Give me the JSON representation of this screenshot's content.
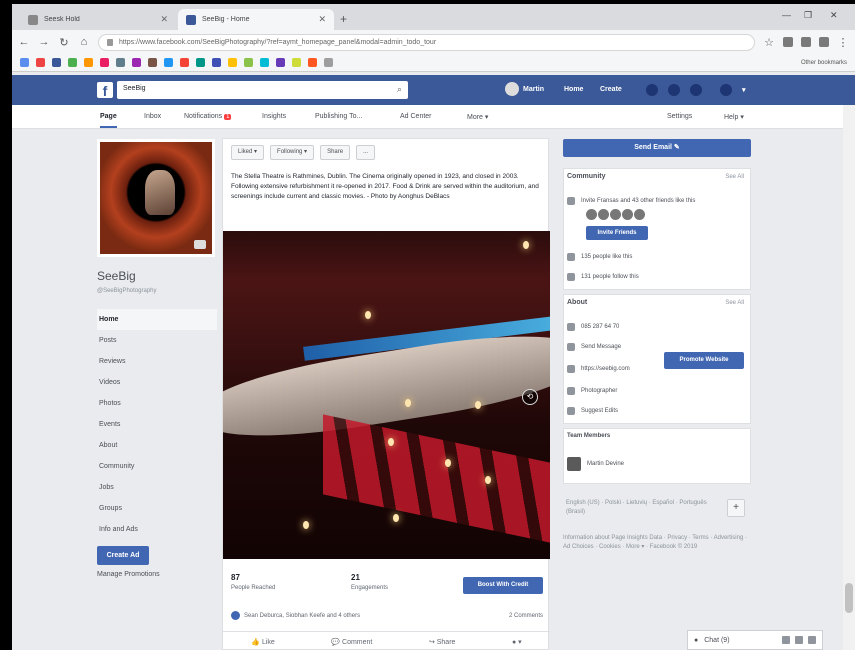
{
  "browser": {
    "tabs": [
      {
        "label": "Seesk Hold"
      },
      {
        "label": "SeeBig - Home"
      }
    ],
    "new_tab": "+",
    "url": "https://www.facebook.com/SeeBigPhotography/?ref=aymt_homepage_panel&modal=admin_todo_tour",
    "window_controls": [
      "—",
      "❐",
      "✕"
    ],
    "bookmarks_other": "Other bookmarks"
  },
  "fb": {
    "logo": "f",
    "search_value": "SeeBig",
    "user_name": "Martin",
    "nav": [
      "Home",
      "Create"
    ]
  },
  "page_tabs": [
    "Page",
    "Inbox",
    "Notifications",
    "Insights",
    "Publishing To...",
    "Ad Center",
    "More ▾",
    "Settings",
    "Help ▾"
  ],
  "notif_count": "1",
  "page": {
    "name": "SeeBig",
    "handle": "@SeeBigPhotography",
    "nav": [
      "Home",
      "Posts",
      "Reviews",
      "Videos",
      "Photos",
      "Events",
      "About",
      "Community",
      "Jobs",
      "Groups",
      "Info and Ads"
    ],
    "create_ad": "Create Ad",
    "manage_promotions": "Manage Promotions"
  },
  "post": {
    "actions": [
      "Liked ▾",
      "Following ▾",
      "Share",
      "..."
    ],
    "text": "The Stella Theatre is Rathmines, Dublin. The Cinema originally opened in 1923, and closed in 2003. Following extensive refurbishment it re-opened in 2017. Food & Drink are served within the auditorium, and screenings include current and classic movies. - Photo by Aonghus DeBlacs",
    "people_reached": "87",
    "people_reached_label": "People Reached",
    "engagements": "21",
    "engagements_label": "Engagements",
    "boost_label": "Boost With Credit",
    "reactions_text": "Sean Deburca, Siobhan Keefe and 4 others",
    "comments_text": "2 Comments",
    "bar": [
      "Like",
      "Comment",
      "Share"
    ]
  },
  "right": {
    "send_email": "Send Email",
    "community": {
      "title": "Community",
      "see_all": "See All",
      "invite_text": "Invite Fransas and 43 other friends like this",
      "invite_button": "Invite Friends",
      "likes": "135 people like this",
      "follows": "131 people follow this"
    },
    "about": {
      "title": "About",
      "see_all": "See All",
      "phone": "085 287 64 70",
      "send_message": "Send Message",
      "website": "https://seebig.com",
      "promote_button": "Promote Website",
      "category": "Photographer",
      "suggest": "Suggest Edits"
    },
    "team": {
      "title": "Team Members",
      "member": "Martin Devine"
    },
    "languages": "English (US) · Polski · Lietuvių · Español · Português (Brasil)",
    "lang_plus": "+",
    "footer": "Information about Page Insights Data · Privacy · Terms · Advertising · Ad Choices · Cookies · More ▾ · Facebook © 2019"
  },
  "chat": {
    "label": "Chat (9)"
  },
  "colors": {
    "fb_blue": "#3b5998",
    "button_blue": "#4267b2",
    "page_bg": "#e9ebee"
  }
}
